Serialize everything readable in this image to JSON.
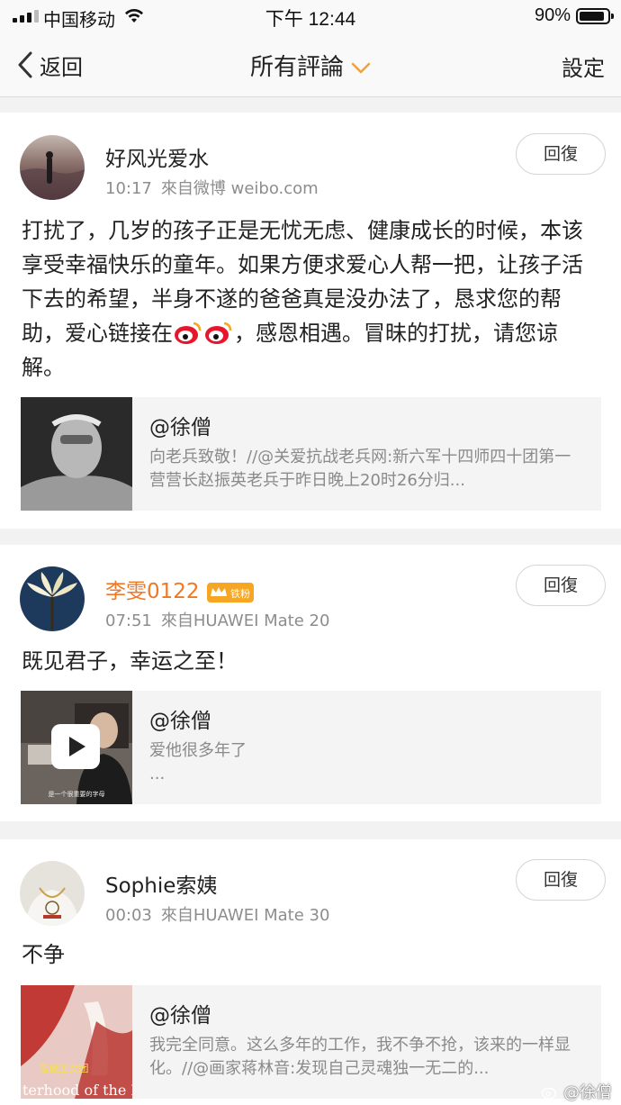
{
  "status": {
    "carrier": "中国移动",
    "time": "下午 12:44",
    "battery": "90%",
    "battery_level": 0.9
  },
  "nav": {
    "back_label": "返回",
    "title": "所有評論",
    "settings_label": "設定"
  },
  "comments": [
    {
      "username": "好风光爱水",
      "time": "10:17",
      "source": "來自微博 weibo.com",
      "reply_label": "回復",
      "text_parts": [
        "打扰了，几岁的孩子正是无忧无虑、健康成长的时候，本该享受幸福快乐的童年。如果方便求爱心人帮一把，让孩子活下去的希望，半身不遂的爸爸真是没办法了，恳求您的帮助，爱心链接在",
        "，感恩相遇。冒昧的打扰，请您谅解。"
      ],
      "quote": {
        "author": "@徐僧",
        "text": "向老兵致敬！//@关爱抗战老兵网:新六军十四师四十团第一营营长赵振英老兵于昨日晚上20时26分归..."
      }
    },
    {
      "username": "李雯0122",
      "badge": "铁粉",
      "time": "07:51",
      "source": "來自HUAWEI Mate 20",
      "reply_label": "回復",
      "text": "既见君子，幸运之至！",
      "quote": {
        "author": "@徐僧",
        "text": "爱他很多年了",
        "more": "...",
        "thumb_caption": "是一个很重要的字母"
      }
    },
    {
      "username": "Sophie索姨",
      "time": "00:03",
      "source": "來自HUAWEI Mate 30",
      "reply_label": "回復",
      "text": "不争",
      "quote": {
        "author": "@徐僧",
        "text": "我完全同意。这么多年的工作，我不争不抢，该来的一样显化。//@画家蒋林音:发现自己灵魂独一无二的...",
        "thumb_caption_1": "蔷薇圣女团",
        "thumb_caption_2": "terhood of the R"
      }
    }
  ],
  "watermark": "@徐僧"
}
